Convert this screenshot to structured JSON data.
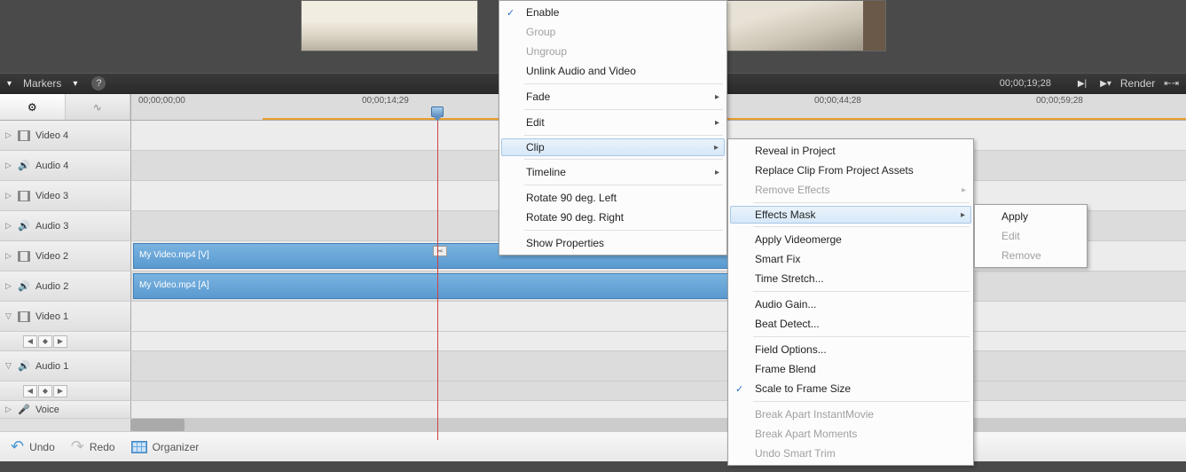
{
  "toolbar": {
    "markers_label": "Markers",
    "timecode": "00;00;19;28",
    "render_label": "Render"
  },
  "ruler_ticks": [
    {
      "pos": 8,
      "label": "00;00;00;00"
    },
    {
      "pos": 260,
      "label": "00;00;14;29"
    },
    {
      "pos": 770,
      "label": "00;00;44;28"
    },
    {
      "pos": 1020,
      "label": "00;00;59;28"
    }
  ],
  "tracks": [
    {
      "name": "Video 4",
      "kind": "video",
      "expand": "▷"
    },
    {
      "name": "Audio 4",
      "kind": "audio",
      "expand": "▷"
    },
    {
      "name": "Video 3",
      "kind": "video",
      "expand": "▷"
    },
    {
      "name": "Audio 3",
      "kind": "audio",
      "expand": "▷"
    },
    {
      "name": "Video 2",
      "kind": "video",
      "expand": "▷",
      "clip": "My Video.mp4 [V]",
      "clip_class": "clip-v",
      "show_marker": true
    },
    {
      "name": "Audio 2",
      "kind": "audio",
      "expand": "▷",
      "clip": "My Video.mp4 [A]",
      "clip_class": "clip-a"
    },
    {
      "name": "Video 1",
      "kind": "video",
      "expand": "▽",
      "controls": true
    },
    {
      "name": "Audio 1",
      "kind": "audio",
      "expand": "▽",
      "controls": true
    }
  ],
  "voice_track": {
    "name": "Voice",
    "expand": "▷"
  },
  "bottom": {
    "undo": "Undo",
    "redo": "Redo",
    "organizer": "Organizer"
  },
  "menu1": [
    {
      "label": "Enable",
      "checked": true
    },
    {
      "label": "Group",
      "disabled": true
    },
    {
      "label": "Ungroup",
      "disabled": true
    },
    {
      "label": "Unlink Audio and Video"
    },
    {
      "sep": true
    },
    {
      "label": "Fade",
      "sub": true
    },
    {
      "sep": true
    },
    {
      "label": "Edit",
      "sub": true
    },
    {
      "sep": true
    },
    {
      "label": "Clip",
      "sub": true,
      "highlighted": true
    },
    {
      "sep": true
    },
    {
      "label": "Timeline",
      "sub": true
    },
    {
      "sep": true
    },
    {
      "label": "Rotate 90 deg. Left"
    },
    {
      "label": "Rotate 90 deg. Right"
    },
    {
      "sep": true
    },
    {
      "label": "Show Properties"
    }
  ],
  "menu2": [
    {
      "label": "Reveal in Project"
    },
    {
      "label": "Replace Clip From Project Assets"
    },
    {
      "label": "Remove Effects",
      "disabled": true,
      "sub": true
    },
    {
      "sep": true
    },
    {
      "label": "Effects Mask",
      "sub": true,
      "highlighted": true
    },
    {
      "sep": true
    },
    {
      "label": "Apply Videomerge"
    },
    {
      "label": "Smart Fix"
    },
    {
      "label": "Time Stretch..."
    },
    {
      "sep": true
    },
    {
      "label": "Audio Gain..."
    },
    {
      "label": "Beat Detect..."
    },
    {
      "sep": true
    },
    {
      "label": "Field Options..."
    },
    {
      "label": "Frame Blend"
    },
    {
      "label": "Scale to Frame Size",
      "checked": true
    },
    {
      "sep": true
    },
    {
      "label": "Break Apart InstantMovie",
      "disabled": true
    },
    {
      "label": "Break Apart Moments",
      "disabled": true
    },
    {
      "label": "Undo Smart Trim",
      "disabled": true
    }
  ],
  "menu3": [
    {
      "label": "Apply"
    },
    {
      "label": "Edit",
      "disabled": true
    },
    {
      "label": "Remove",
      "disabled": true
    }
  ]
}
